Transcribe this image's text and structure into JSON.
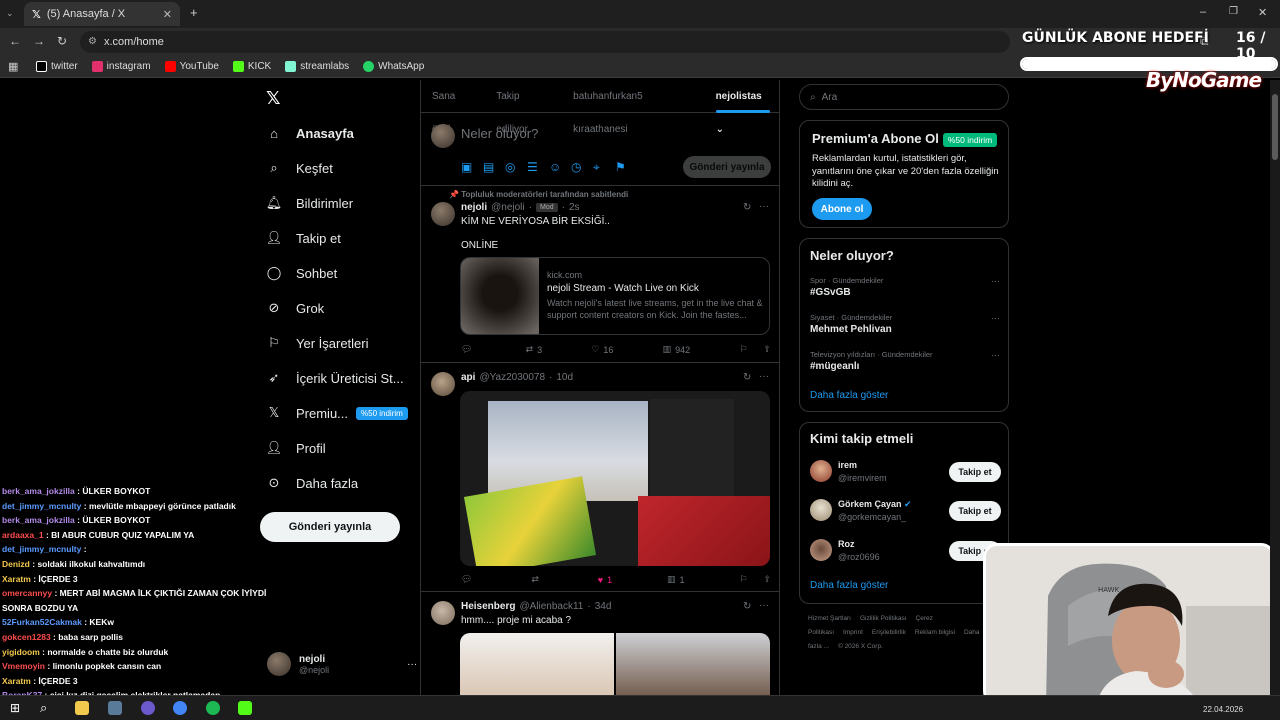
{
  "browser": {
    "tab_title": "(5) Anasayfa / X",
    "url": "x.com/home",
    "bookmarks": [
      {
        "label": "twitter",
        "color": "#ffffff"
      },
      {
        "label": "instagram",
        "color": "#e1306c"
      },
      {
        "label": "YouTube",
        "color": "#ff0000"
      },
      {
        "label": "KICK",
        "color": "#53fc18"
      },
      {
        "label": "streamlabs",
        "color": "#80f5d2"
      },
      {
        "label": "WhatsApp",
        "color": "#25d366"
      }
    ]
  },
  "overlay": {
    "goal_title": "GÜNLÜK ABONE HEDEFİ",
    "goal_count": "16 / 10",
    "goal_progress": 1.0,
    "brand": "ByNoGame"
  },
  "nav": {
    "items": [
      {
        "label": "Anasayfa",
        "icon": "home-icon"
      },
      {
        "label": "Keşfet",
        "icon": "search-icon"
      },
      {
        "label": "Bildirimler",
        "icon": "bell-icon"
      },
      {
        "label": "Takip et",
        "icon": "person-plus-icon"
      },
      {
        "label": "Sohbet",
        "icon": "chat-icon"
      },
      {
        "label": "Grok",
        "icon": "grok-icon"
      },
      {
        "label": "Yer İşaretleri",
        "icon": "bookmark-icon"
      },
      {
        "label": "İçerik Üreticisi St...",
        "icon": "rocket-icon"
      },
      {
        "label": "Premiu...",
        "icon": "x-logo-icon"
      },
      {
        "label": "Profil",
        "icon": "profile-icon"
      },
      {
        "label": "Daha fazla",
        "icon": "more-circle-icon"
      }
    ],
    "premium_badge": "%50 indirim",
    "post_button": "Gönderi yayınla",
    "profile_name": "nejoli",
    "profile_handle": "@nejoli"
  },
  "chat": [
    {
      "user": "berk_ama_jokzilla",
      "msg": "ÜLKER BOYKOT",
      "color": "#b28ae8"
    },
    {
      "user": "det_jimmy_mcnulty",
      "msg": "mevlütle mbappeyi görünce patladık",
      "color": "#5b9bff"
    },
    {
      "user": "berk_ama_jokzilla",
      "msg": "ÜLKER BOYKOT",
      "color": "#b28ae8"
    },
    {
      "user": "ardaaxa_1",
      "msg": "BI ABUR CUBUR QUIZ YAPALIM YA",
      "color": "#ff4d4d"
    },
    {
      "user": "det_jimmy_mcnulty",
      "msg": "",
      "color": "#5b9bff"
    },
    {
      "user": "Denizd",
      "msg": "soldaki ilkokul kahvaltımdı",
      "color": "#f2c94c"
    },
    {
      "user": "Xaratm",
      "msg": "İÇERDE 3",
      "color": "#f2c94c"
    },
    {
      "user": "omercannyy",
      "msg": "MERT ABİ MAGMA İLK ÇIKTIĞI ZAMAN ÇOK İYİYDİ SONRA BOZDU YA",
      "color": "#ff4d4d"
    },
    {
      "user": "52Furkan52Cakmak",
      "msg": "KEKw",
      "color": "#5b9bff"
    },
    {
      "user": "gokcen1283",
      "msg": "baba sarp pollis",
      "color": "#ff4d4d"
    },
    {
      "user": "yigidoom",
      "msg": "normalde o chatte biz olurduk",
      "color": "#f2c94c"
    },
    {
      "user": "Vmemoyin",
      "msg": "limonlu popkek cansın can",
      "color": "#ff4d4d"
    },
    {
      "user": "Xaratm",
      "msg": "İÇERDE 3",
      "color": "#f2c94c"
    },
    {
      "user": "BoranK37",
      "msg": "cici kız dizi gecelim elektrikler patlamadan",
      "color": "#b28ae8"
    }
  ],
  "timeline": {
    "tabs": [
      "Sana özel",
      "Takip ediliyor",
      "batuhanfurkan5 kıraathanesi",
      "nejolistas"
    ],
    "composer_placeholder": "Neler oluyor?",
    "composer_post": "Gönderi yayınla",
    "tweets": [
      {
        "pinned_note": "Topluluk moderatörleri tarafından sabitlendi",
        "name": "nejoli",
        "handle": "@nejoli",
        "mod": "Mod",
        "time": "2s",
        "text": "KİM NE VERİYOSA BİR EKSİĞİ..",
        "text2": "ONLİNE",
        "card_domain": "kick.com",
        "card_title": "nejoli Stream - Watch Live on Kick",
        "card_desc": "Watch nejoli's latest live streams, get in the live chat & support content creators on Kick. Join the fastes...",
        "replies": "",
        "reposts": "3",
        "likes": "16",
        "views": "942"
      },
      {
        "name": "api",
        "handle": "@Yaz2030078",
        "time": "10d",
        "replies": "",
        "reposts": "",
        "likes": "1",
        "views": "1"
      },
      {
        "name": "Heisenberg",
        "handle": "@Alienback11",
        "time": "34d",
        "text": "hmm.... proje mi acaba ?"
      }
    ]
  },
  "right": {
    "search_placeholder": "Ara",
    "premium_title": "Premium'a Abone Ol",
    "premium_badge": "%50 indirim",
    "premium_desc": "Reklamlardan kurtul, istatistikleri gör, yanıtlarını öne çıkar ve 20'den fazla özelliğin kilidini aç.",
    "premium_button": "Abone ol",
    "trends_title": "Neler oluyor?",
    "trends": [
      {
        "category": "Spor · Gündemdekiler",
        "name": "#GSvGB"
      },
      {
        "category": "Siyaset · Gündemdekiler",
        "name": "Mehmet Pehlivan"
      },
      {
        "category": "Televizyon yıldızları · Gündemdekiler",
        "name": "#mügeanlı"
      }
    ],
    "show_more": "Daha fazla göster",
    "follow_title": "Kimi takip etmeli",
    "follow": [
      {
        "name": "irem",
        "handle": "@iremvirem",
        "verified": false
      },
      {
        "name": "Görkem Çayan",
        "handle": "@gorkemcayan_",
        "verified": true
      },
      {
        "name": "Roz",
        "handle": "@roz0696",
        "verified": false
      }
    ],
    "follow_button": "Takip et",
    "footer": [
      "Hizmet Şartları",
      "Gizlilik Politikası",
      "Çerez Politikası",
      "Imprint",
      "Erişilebilirlik",
      "Reklam bilgisi",
      "Daha fazla ...",
      "© 2026 X Corp."
    ]
  },
  "taskbar": {
    "date": "22.04.2026"
  }
}
